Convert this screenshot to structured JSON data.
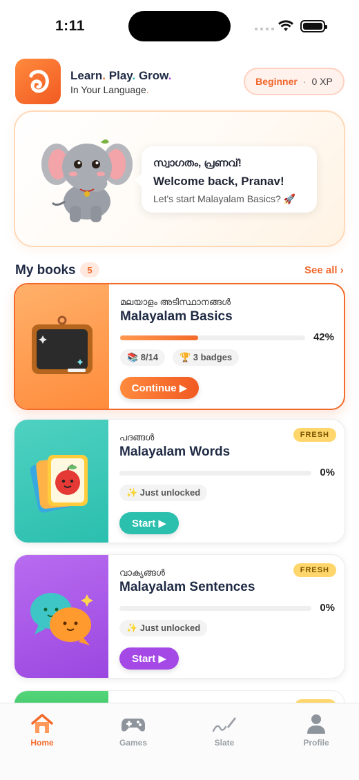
{
  "status_bar": {
    "time": "1:11"
  },
  "header": {
    "tagline_parts": [
      "Learn",
      "Play",
      "Grow"
    ],
    "subtagline": "In Your Language",
    "level": "Beginner",
    "separator": "·",
    "xp": "0 XP"
  },
  "welcome": {
    "greeting_ml": "സ്വാഗതം, പ്രണവ്!",
    "greeting_en": "Welcome back, Pranav!",
    "prompt": "Let's start Malayalam Basics? 🚀"
  },
  "books_section": {
    "title": "My books",
    "count": "5",
    "see_all": "See all ›"
  },
  "books": [
    {
      "title_ml": "മലയാളം അടിസ്ഥാനങ്ങൾ",
      "title": "Malayalam Basics",
      "progress_percent": 42,
      "progress_label": "42%",
      "chips": [
        "📚 8/14",
        "🏆 3 badges"
      ],
      "cta": "Continue ▶",
      "badge": "",
      "accent": "#f26b2a"
    },
    {
      "title_ml": "പദങ്ങൾ",
      "title": "Malayalam Words",
      "progress_percent": 0,
      "progress_label": "0%",
      "chips": [
        "✨ Just unlocked"
      ],
      "cta": "Start ▶",
      "badge": "FRESH",
      "accent": "#2bbfae"
    },
    {
      "title_ml": "വാക്യങ്ങൾ",
      "title": "Malayalam Sentences",
      "progress_percent": 0,
      "progress_label": "0%",
      "chips": [
        "✨ Just unlocked"
      ],
      "cta": "Start ▶",
      "badge": "FRESH",
      "accent": "#a448e6"
    }
  ],
  "tabs": [
    {
      "label": "Home",
      "icon": "home-icon",
      "active": true
    },
    {
      "label": "Games",
      "icon": "gamepad-icon",
      "active": false
    },
    {
      "label": "Slate",
      "icon": "pen-icon",
      "active": false
    },
    {
      "label": "Profile",
      "icon": "person-icon",
      "active": false
    }
  ],
  "colors": {
    "brand": "#f26b2a",
    "teal": "#2bbfae",
    "purple": "#a448e6",
    "fresh": "#ffd66b"
  }
}
